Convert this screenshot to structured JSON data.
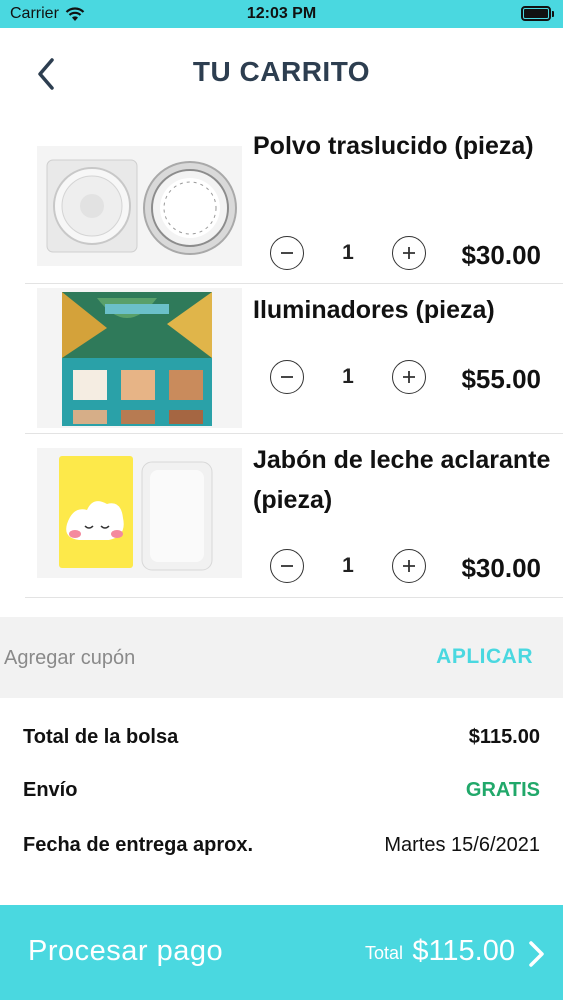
{
  "status_bar": {
    "carrier": "Carrier",
    "time": "12:03 PM"
  },
  "header": {
    "title": "TU CARRITO"
  },
  "cart": {
    "items": [
      {
        "name": "Polvo traslucido (pieza)",
        "quantity": "1",
        "price": "$30.00"
      },
      {
        "name": "Iluminadores (pieza)",
        "quantity": "1",
        "price": "$55.00"
      },
      {
        "name": "Jabón de leche aclarante (pieza)",
        "quantity": "1",
        "price": "$30.00"
      }
    ]
  },
  "coupon": {
    "placeholder": "Agregar cupón",
    "apply_label": "APLICAR"
  },
  "summary": {
    "bag_total_label": "Total de la bolsa",
    "bag_total_value": "$115.00",
    "shipping_label": "Envío",
    "shipping_value": "GRATIS",
    "delivery_label": "Fecha de entrega aprox.",
    "delivery_value": "Martes 15/6/2021"
  },
  "checkout": {
    "label": "Procesar pago",
    "total_label": "Total",
    "total_value": "$115.00"
  },
  "colors": {
    "accent": "#4ad8e0",
    "title": "#2d3e50",
    "free_shipping": "#21a86a"
  },
  "icons": [
    "wifi-icon",
    "battery-icon",
    "back-chevron-icon",
    "minus-icon",
    "plus-icon",
    "chevron-right-icon"
  ]
}
